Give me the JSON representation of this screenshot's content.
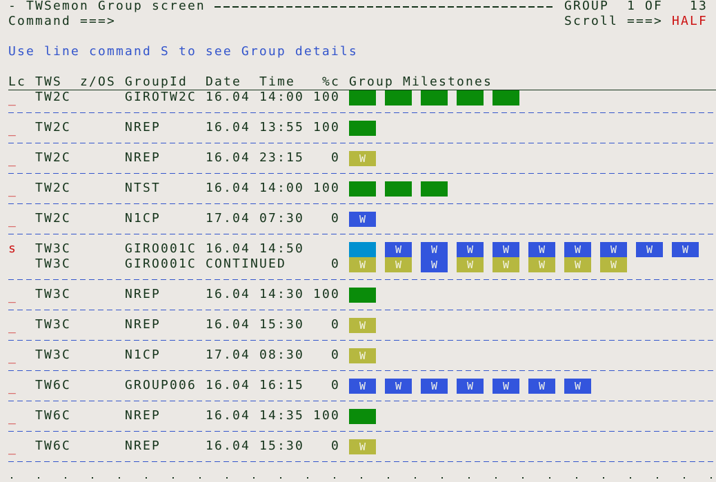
{
  "header": {
    "title": "- TWSemon Group screen",
    "position": "GROUP  1 OF   13",
    "command_label": "Command ===>",
    "command_value": "",
    "scroll_label": "Scroll ===>",
    "scroll_value": "HALF"
  },
  "instruction": "Use line command S to see Group details",
  "columns": [
    "Lc",
    "TWS",
    "z/OS",
    "GroupId",
    "Date",
    "Time",
    "%c",
    "Group Milestones"
  ],
  "colors": {
    "complete": "#0a8c0a",
    "waiting": "#b6b840",
    "waiting_blue": "#3355dd",
    "active": "#0090d0",
    "text": "#14331a",
    "info": "#3355cc",
    "alert": "#cc1111"
  },
  "groups": [
    {
      "lc": "_",
      "tws": "TW2C",
      "zos": "",
      "group": "GIROTW2C",
      "date": "16.04",
      "time": "14:00",
      "pct": "100",
      "milestones": [
        {
          "c": "complete",
          "l": ""
        },
        {
          "c": "complete",
          "l": ""
        },
        {
          "c": "complete",
          "l": ""
        },
        {
          "c": "complete",
          "l": ""
        },
        {
          "c": "complete",
          "l": ""
        }
      ]
    },
    {
      "lc": "_",
      "tws": "TW2C",
      "zos": "",
      "group": "NREP",
      "date": "16.04",
      "time": "13:55",
      "pct": "100",
      "milestones": [
        {
          "c": "complete",
          "l": ""
        }
      ]
    },
    {
      "lc": "_",
      "tws": "TW2C",
      "zos": "",
      "group": "NREP",
      "date": "16.04",
      "time": "23:15",
      "pct": "0",
      "milestones": [
        {
          "c": "waiting",
          "l": "W"
        }
      ]
    },
    {
      "lc": "_",
      "tws": "TW2C",
      "zos": "",
      "group": "NTST",
      "date": "16.04",
      "time": "14:00",
      "pct": "100",
      "milestones": [
        {
          "c": "complete",
          "l": ""
        },
        {
          "c": "complete",
          "l": ""
        },
        {
          "c": "complete",
          "l": ""
        }
      ]
    },
    {
      "lc": "_",
      "tws": "TW2C",
      "zos": "",
      "group": "N1CP",
      "date": "17.04",
      "time": "07:30",
      "pct": "0",
      "milestones": [
        {
          "c": "waiting_blue",
          "l": "W"
        }
      ]
    },
    {
      "lc": "s",
      "tws": "TW3C",
      "zos": "",
      "group": "GIRO001C",
      "date": "16.04",
      "time": "14:50",
      "pct": "",
      "milestones": [
        {
          "c": "active",
          "l": ""
        },
        {
          "c": "waiting_blue",
          "l": "W"
        },
        {
          "c": "waiting_blue",
          "l": "W"
        },
        {
          "c": "waiting_blue",
          "l": "W"
        },
        {
          "c": "waiting_blue",
          "l": "W"
        },
        {
          "c": "waiting_blue",
          "l": "W"
        },
        {
          "c": "waiting_blue",
          "l": "W"
        },
        {
          "c": "waiting_blue",
          "l": "W"
        },
        {
          "c": "waiting_blue",
          "l": "W"
        },
        {
          "c": "waiting_blue",
          "l": "W"
        }
      ],
      "continuation": {
        "tws": "TW3C",
        "group": "GIRO001C",
        "date": "CONTINUED",
        "pct": "0",
        "milestones": [
          {
            "c": "waiting",
            "l": "W"
          },
          {
            "c": "waiting",
            "l": "W"
          },
          {
            "c": "waiting_blue",
            "l": "W"
          },
          {
            "c": "waiting",
            "l": "W"
          },
          {
            "c": "waiting",
            "l": "W"
          },
          {
            "c": "waiting",
            "l": "W"
          },
          {
            "c": "waiting",
            "l": "W"
          },
          {
            "c": "waiting",
            "l": "W"
          }
        ]
      }
    },
    {
      "lc": "_",
      "tws": "TW3C",
      "zos": "",
      "group": "NREP",
      "date": "16.04",
      "time": "14:30",
      "pct": "100",
      "milestones": [
        {
          "c": "complete",
          "l": ""
        }
      ]
    },
    {
      "lc": "_",
      "tws": "TW3C",
      "zos": "",
      "group": "NREP",
      "date": "16.04",
      "time": "15:30",
      "pct": "0",
      "milestones": [
        {
          "c": "waiting",
          "l": "W"
        }
      ]
    },
    {
      "lc": "_",
      "tws": "TW3C",
      "zos": "",
      "group": "N1CP",
      "date": "17.04",
      "time": "08:30",
      "pct": "0",
      "milestones": [
        {
          "c": "waiting",
          "l": "W"
        }
      ]
    },
    {
      "lc": "_",
      "tws": "TW6C",
      "zos": "",
      "group": "GROUP006",
      "date": "16.04",
      "time": "16:15",
      "pct": "0",
      "milestones": [
        {
          "c": "waiting_blue",
          "l": "W"
        },
        {
          "c": "waiting_blue",
          "l": "W"
        },
        {
          "c": "waiting_blue",
          "l": "W"
        },
        {
          "c": "waiting_blue",
          "l": "W"
        },
        {
          "c": "waiting_blue",
          "l": "W"
        },
        {
          "c": "waiting_blue",
          "l": "W"
        },
        {
          "c": "waiting_blue",
          "l": "W"
        }
      ]
    },
    {
      "lc": "_",
      "tws": "TW6C",
      "zos": "",
      "group": "NREP",
      "date": "16.04",
      "time": "14:35",
      "pct": "100",
      "milestones": [
        {
          "c": "complete",
          "l": ""
        }
      ]
    },
    {
      "lc": "_",
      "tws": "TW6C",
      "zos": "",
      "group": "NREP",
      "date": "16.04",
      "time": "15:30",
      "pct": "0",
      "milestones": [
        {
          "c": "waiting",
          "l": "W"
        }
      ]
    }
  ]
}
